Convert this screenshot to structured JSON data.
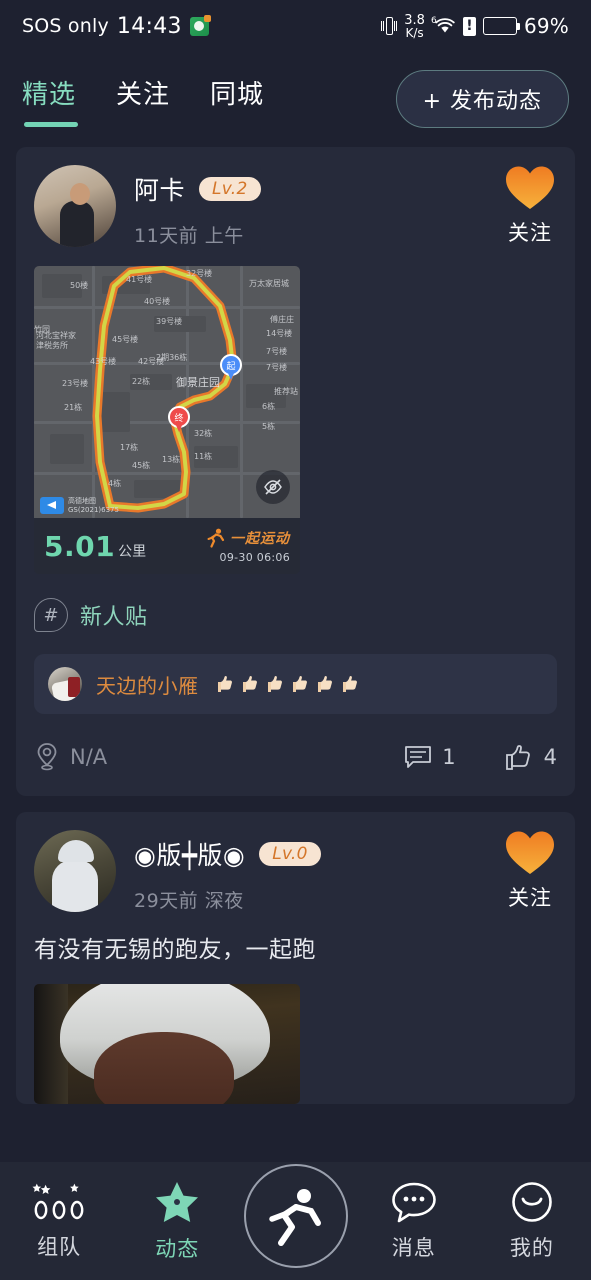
{
  "status_bar": {
    "carrier": "SOS only",
    "time": "14:43",
    "app_icon": "green-app-icon",
    "vibrate_icon": "vibrate-icon",
    "net_speed_value": "3.8",
    "net_speed_unit": "K/s",
    "wifi_icon": "wifi-icon",
    "wifi_superscript": "6",
    "alert_icon": "sim-alert-icon",
    "battery_icon": "battery-icon",
    "battery_percent": "69%",
    "battery_level": 69
  },
  "tabs": {
    "items": [
      {
        "label": "精选",
        "active": true
      },
      {
        "label": "关注",
        "active": false
      },
      {
        "label": "同城",
        "active": false
      }
    ],
    "post_button": "+ 发布动态"
  },
  "posts": [
    {
      "author": "阿卡",
      "level": "Lv.2",
      "time": "11天前 上午",
      "follow_label": "关注",
      "follow_icon": "heart-icon",
      "map": {
        "distance_value": "5.01",
        "distance_unit": "公里",
        "brand": "一起运动",
        "brand_icon": "runner-icon",
        "datetime": "09-30 06:06",
        "hide_icon": "eye-off-icon",
        "attribution_line1": "高德地图",
        "attribution_line2": "GS(2021)6375",
        "start_pin": "起",
        "end_pin": "终",
        "labels": [
          "50楼",
          "41号楼",
          "32号楼",
          "万太家居城",
          "40号楼",
          "39号楼",
          "14号楼",
          "45号楼",
          "2期36栋",
          "7号楼",
          "43号楼",
          "42号楼",
          "22栋",
          "御景庄园",
          "23号楼",
          "21栋",
          "6栋",
          "5栋",
          "32栋",
          "17栋",
          "11栋",
          "13栋",
          "45栋",
          "4栋",
          "竹园",
          "河北宝祥家",
          "津税务所",
          "推荐站",
          "傅庄庄"
        ]
      },
      "hashtag": {
        "icon": "hashtag-icon",
        "label": "新人贴"
      },
      "comment": {
        "avatar": "commenter-avatar",
        "name": "天边的小雁",
        "emoji_count": 6,
        "emoji": "thumbs-up"
      },
      "location_icon": "location-pin-icon",
      "location": "N/A",
      "comment_icon": "comment-icon",
      "comment_count": "1",
      "like_icon": "thumbs-up-icon",
      "like_count": "4"
    },
    {
      "author": "◉版┿版◉",
      "level": "Lv.0",
      "time": "29天前 深夜",
      "follow_label": "关注",
      "follow_icon": "heart-icon",
      "text": "有没有无锡的跑友，一起跑",
      "photo": "hooded-person-photo"
    }
  ],
  "bottom_nav": [
    {
      "label": "组队",
      "icon": "team-icon",
      "active": false
    },
    {
      "label": "动态",
      "icon": "star-icon",
      "active": true
    },
    {
      "label": "",
      "icon": "runner-ring-icon",
      "active": false,
      "center": true
    },
    {
      "label": "消息",
      "icon": "message-icon",
      "active": false
    },
    {
      "label": "我的",
      "icon": "smiley-icon",
      "active": false
    }
  ],
  "colors": {
    "page_bg": "#1e2130",
    "card_bg": "#262a3a",
    "accent_teal": "#7ed6b6",
    "accent_orange": "#e8903a",
    "heart_top": "#ef7c22",
    "heart_bottom": "#f7b23c",
    "muted_text": "#8b8f9c"
  }
}
